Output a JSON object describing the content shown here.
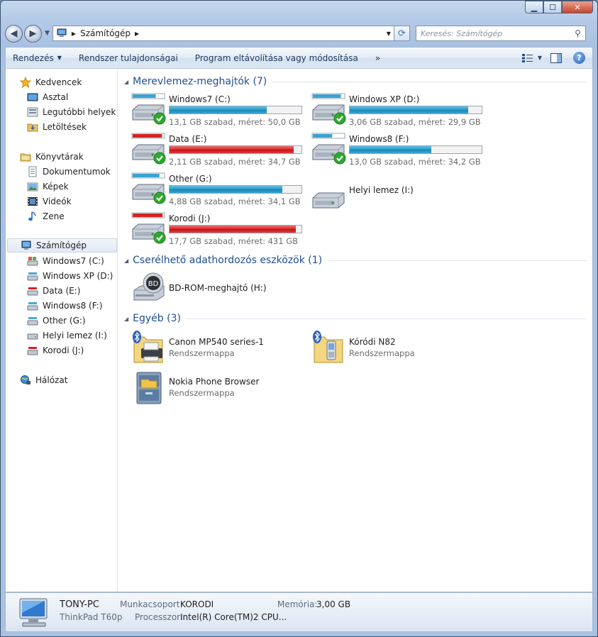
{
  "window": {
    "minimize": "▁",
    "maximize": "☐",
    "close": "✕"
  },
  "nav": {
    "back_glyph": "◀",
    "forward_glyph": "▶",
    "address_crumb": "Számítógép",
    "search_placeholder": "Keresés: Számítógép"
  },
  "toolbar": {
    "organize": "Rendezés",
    "system_properties": "Rendszer tulajdonságai",
    "uninstall": "Program eltávolítása vagy módosítása",
    "more": "»"
  },
  "sidebar": {
    "favorites": "Kedvencek",
    "desktop": "Asztal",
    "recent": "Legutóbbi helyek",
    "downloads": "Letöltések",
    "libraries": "Könyvtárak",
    "documents": "Dokumentumok",
    "pictures": "Képek",
    "videos": "Videók",
    "music": "Zene",
    "computer": "Számítógép",
    "drives": [
      "Windows7 (C:)",
      "Windows XP (D:)",
      "Data (E:)",
      "Windows8 (F:)",
      "Other (G:)",
      "Helyi lemez (I:)",
      "Korodi (J:)"
    ],
    "network": "Hálózat"
  },
  "groups": {
    "hard_drives": "Merevlemez-meghajtók (7)",
    "removable": "Cserélhető adathordozós eszközök (1)",
    "other": "Egyéb (3)"
  },
  "hard_drives": [
    {
      "name": "Windows7 (C:)",
      "info": "13,1 GB szabad, méret: 50,0 GB",
      "used_fraction": 0.738,
      "color": "blue"
    },
    {
      "name": "Windows XP (D:)",
      "info": "3,06 GB szabad, méret: 29,9 GB",
      "used_fraction": 0.898,
      "color": "blue"
    },
    {
      "name": "Data (E:)",
      "info": "2,11 GB szabad, méret: 34,7 GB",
      "used_fraction": 0.939,
      "color": "red"
    },
    {
      "name": "Windows8 (F:)",
      "info": "13,0 GB szabad, méret: 34,2 GB",
      "used_fraction": 0.62,
      "color": "blue"
    },
    {
      "name": "Other (G:)",
      "info": "4,88 GB szabad, méret: 34,1 GB",
      "used_fraction": 0.857,
      "color": "blue"
    },
    {
      "name": "Helyi lemez (I:)",
      "info": "",
      "used_fraction": null,
      "color": ""
    },
    {
      "name": "Korodi (J:)",
      "info": "17,7 GB szabad, méret: 431 GB",
      "used_fraction": 0.959,
      "color": "red"
    }
  ],
  "removable": [
    {
      "name": "BD-ROM-meghajtó (H:)"
    }
  ],
  "other_items": [
    {
      "name": "Canon MP540 series-1",
      "sub": "Rendszermappa"
    },
    {
      "name": "Kóródi N82",
      "sub": "Rendszermappa"
    },
    {
      "name": "Nokia Phone Browser",
      "sub": "Rendszermappa"
    }
  ],
  "details": {
    "pc_name": "TONY-PC",
    "model": "ThinkPad T60p",
    "workgroup_label": "Munkacsoport:",
    "workgroup": "KORODI",
    "memory_label": "Memória:",
    "memory": "3,00 GB",
    "processor_label": "Processzor:",
    "processor": "Intel(R) Core(TM)2 CPU..."
  },
  "colors": {
    "bar_blue": "#2696c5",
    "bar_red": "#d42323",
    "group_heading": "#1e4e92",
    "check_green": "#2fa82f"
  }
}
